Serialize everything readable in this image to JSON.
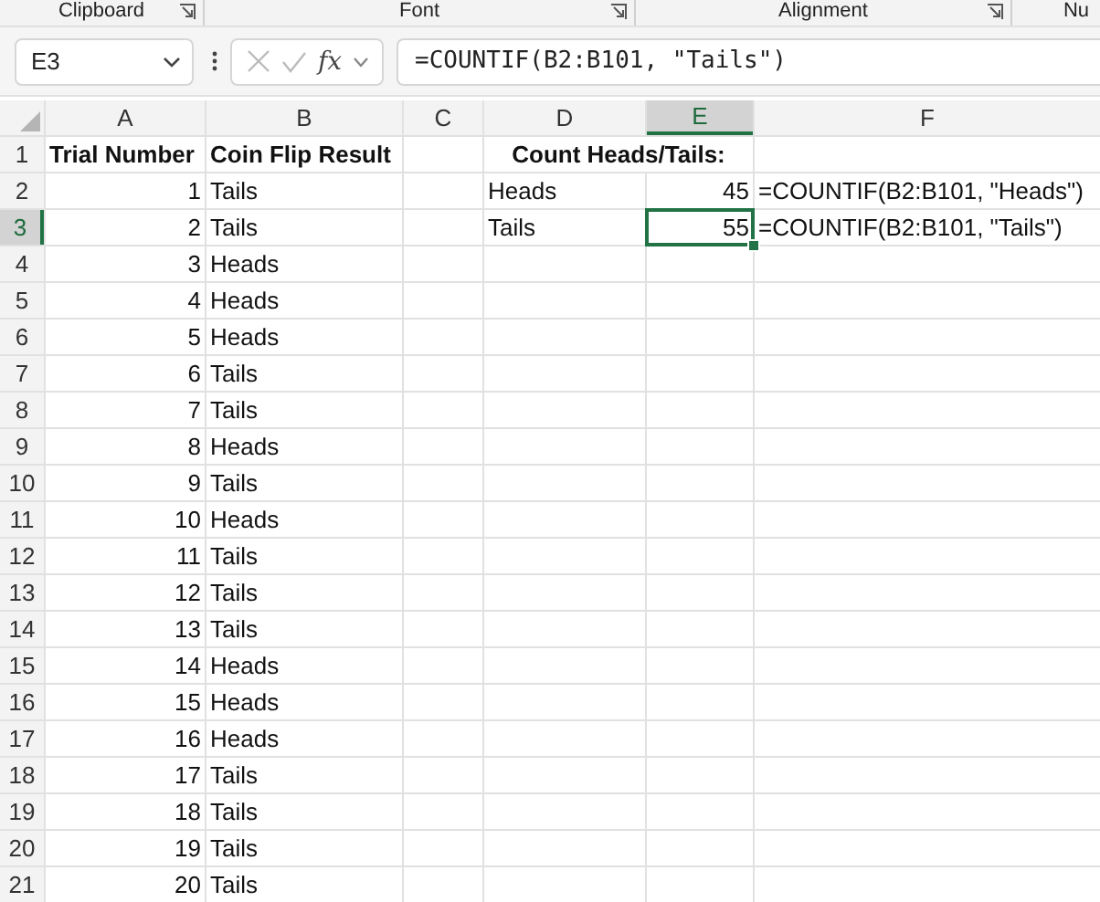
{
  "ribbon": {
    "groups": [
      {
        "label": "Clipboard",
        "launcher": true
      },
      {
        "label": "Font",
        "launcher": true
      },
      {
        "label": "Alignment",
        "launcher": true
      },
      {
        "label": "Nu",
        "launcher": false
      }
    ]
  },
  "formula_bar": {
    "name_box": "E3",
    "function_button": "fx",
    "formula": "=COUNTIF(B2:B101, \"Tails\")"
  },
  "sheet": {
    "columns": [
      {
        "label": "A",
        "selected": false
      },
      {
        "label": "B",
        "selected": false
      },
      {
        "label": "C",
        "selected": false
      },
      {
        "label": "D",
        "selected": false
      },
      {
        "label": "E",
        "selected": true
      },
      {
        "label": "F",
        "selected": false
      }
    ],
    "rows": [
      {
        "number": "1",
        "selected": false,
        "kind": "header",
        "cells": {
          "A": "Trial Number",
          "B": "Coin Flip Result",
          "D": "Count Heads/Tails:"
        }
      },
      {
        "number": "2",
        "selected": false,
        "kind": "data",
        "cells": {
          "A": "1",
          "B": "Tails",
          "D": "Heads",
          "E": "45",
          "F": "=COUNTIF(B2:B101, \"Heads\")"
        }
      },
      {
        "number": "3",
        "selected": true,
        "kind": "data",
        "cells": {
          "A": "2",
          "B": "Tails",
          "D": "Tails",
          "E": "55",
          "F": "=COUNTIF(B2:B101, \"Tails\")"
        }
      },
      {
        "number": "4",
        "selected": false,
        "kind": "data",
        "cells": {
          "A": "3",
          "B": "Heads"
        }
      },
      {
        "number": "5",
        "selected": false,
        "kind": "data",
        "cells": {
          "A": "4",
          "B": "Heads"
        }
      },
      {
        "number": "6",
        "selected": false,
        "kind": "data",
        "cells": {
          "A": "5",
          "B": "Heads"
        }
      },
      {
        "number": "7",
        "selected": false,
        "kind": "data",
        "cells": {
          "A": "6",
          "B": "Tails"
        }
      },
      {
        "number": "8",
        "selected": false,
        "kind": "data",
        "cells": {
          "A": "7",
          "B": "Tails"
        }
      },
      {
        "number": "9",
        "selected": false,
        "kind": "data",
        "cells": {
          "A": "8",
          "B": "Heads"
        }
      },
      {
        "number": "10",
        "selected": false,
        "kind": "data",
        "cells": {
          "A": "9",
          "B": "Tails"
        }
      },
      {
        "number": "11",
        "selected": false,
        "kind": "data",
        "cells": {
          "A": "10",
          "B": "Heads"
        }
      },
      {
        "number": "12",
        "selected": false,
        "kind": "data",
        "cells": {
          "A": "11",
          "B": "Tails"
        }
      },
      {
        "number": "13",
        "selected": false,
        "kind": "data",
        "cells": {
          "A": "12",
          "B": "Tails"
        }
      },
      {
        "number": "14",
        "selected": false,
        "kind": "data",
        "cells": {
          "A": "13",
          "B": "Tails"
        }
      },
      {
        "number": "15",
        "selected": false,
        "kind": "data",
        "cells": {
          "A": "14",
          "B": "Heads"
        }
      },
      {
        "number": "16",
        "selected": false,
        "kind": "data",
        "cells": {
          "A": "15",
          "B": "Heads"
        }
      },
      {
        "number": "17",
        "selected": false,
        "kind": "data",
        "cells": {
          "A": "16",
          "B": "Heads"
        }
      },
      {
        "number": "18",
        "selected": false,
        "kind": "data",
        "cells": {
          "A": "17",
          "B": "Tails"
        }
      },
      {
        "number": "19",
        "selected": false,
        "kind": "data",
        "cells": {
          "A": "18",
          "B": "Tails"
        }
      },
      {
        "number": "20",
        "selected": false,
        "kind": "data",
        "cells": {
          "A": "19",
          "B": "Tails"
        }
      },
      {
        "number": "21",
        "selected": false,
        "kind": "data",
        "cells": {
          "A": "20",
          "B": "Tails"
        }
      }
    ]
  }
}
